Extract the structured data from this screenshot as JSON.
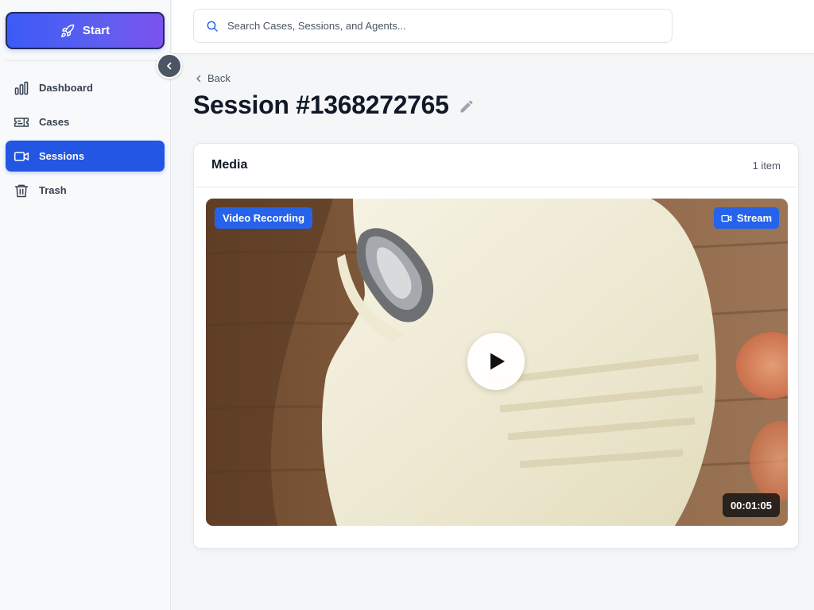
{
  "colors": {
    "accent": "#2256e3",
    "badge": "#2563eb",
    "start_gradient_from": "#3b5bf6",
    "start_gradient_to": "#7b52ee"
  },
  "sidebar": {
    "start_label": "Start",
    "start_icon": "rocket-icon",
    "collapse_icon": "chevron-left-icon",
    "items": [
      {
        "label": "Dashboard",
        "icon": "bar-chart-icon",
        "active": false
      },
      {
        "label": "Cases",
        "icon": "ticket-icon",
        "active": false
      },
      {
        "label": "Sessions",
        "icon": "video-camera-icon",
        "active": true
      },
      {
        "label": "Trash",
        "icon": "trash-icon",
        "active": false
      }
    ]
  },
  "header": {
    "search_placeholder": "Search Cases, Sessions, and Agents...",
    "search_value": "",
    "search_icon": "search-icon"
  },
  "main": {
    "back_label": "Back",
    "title": "Session #1368272765",
    "edit_icon": "pencil-icon"
  },
  "media": {
    "title": "Media",
    "count_label": "1 item",
    "video": {
      "type_badge": "Video Recording",
      "stream_label": "Stream",
      "stream_icon": "video-camera-icon",
      "play_icon": "play-icon",
      "duration": "00:01:05"
    }
  }
}
